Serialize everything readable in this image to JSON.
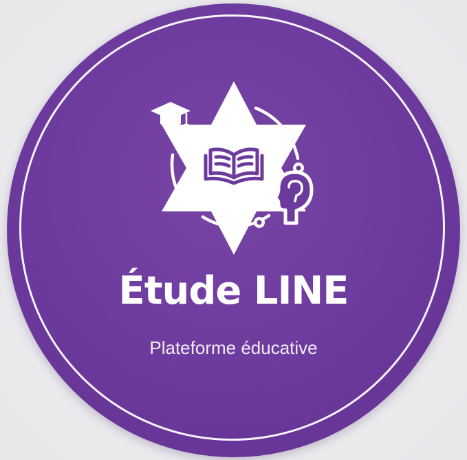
{
  "logo": {
    "title": "Étude LINE",
    "subtitle": "Plateforme éducative",
    "colors": {
      "background": "#ececee",
      "badge": "#6c3a9d",
      "foreground": "#ffffff"
    },
    "icons": [
      "star-emblem-icon",
      "graduation-cap-icon",
      "open-book-icon",
      "head-profile-icon",
      "orbit-path-icon"
    ]
  }
}
